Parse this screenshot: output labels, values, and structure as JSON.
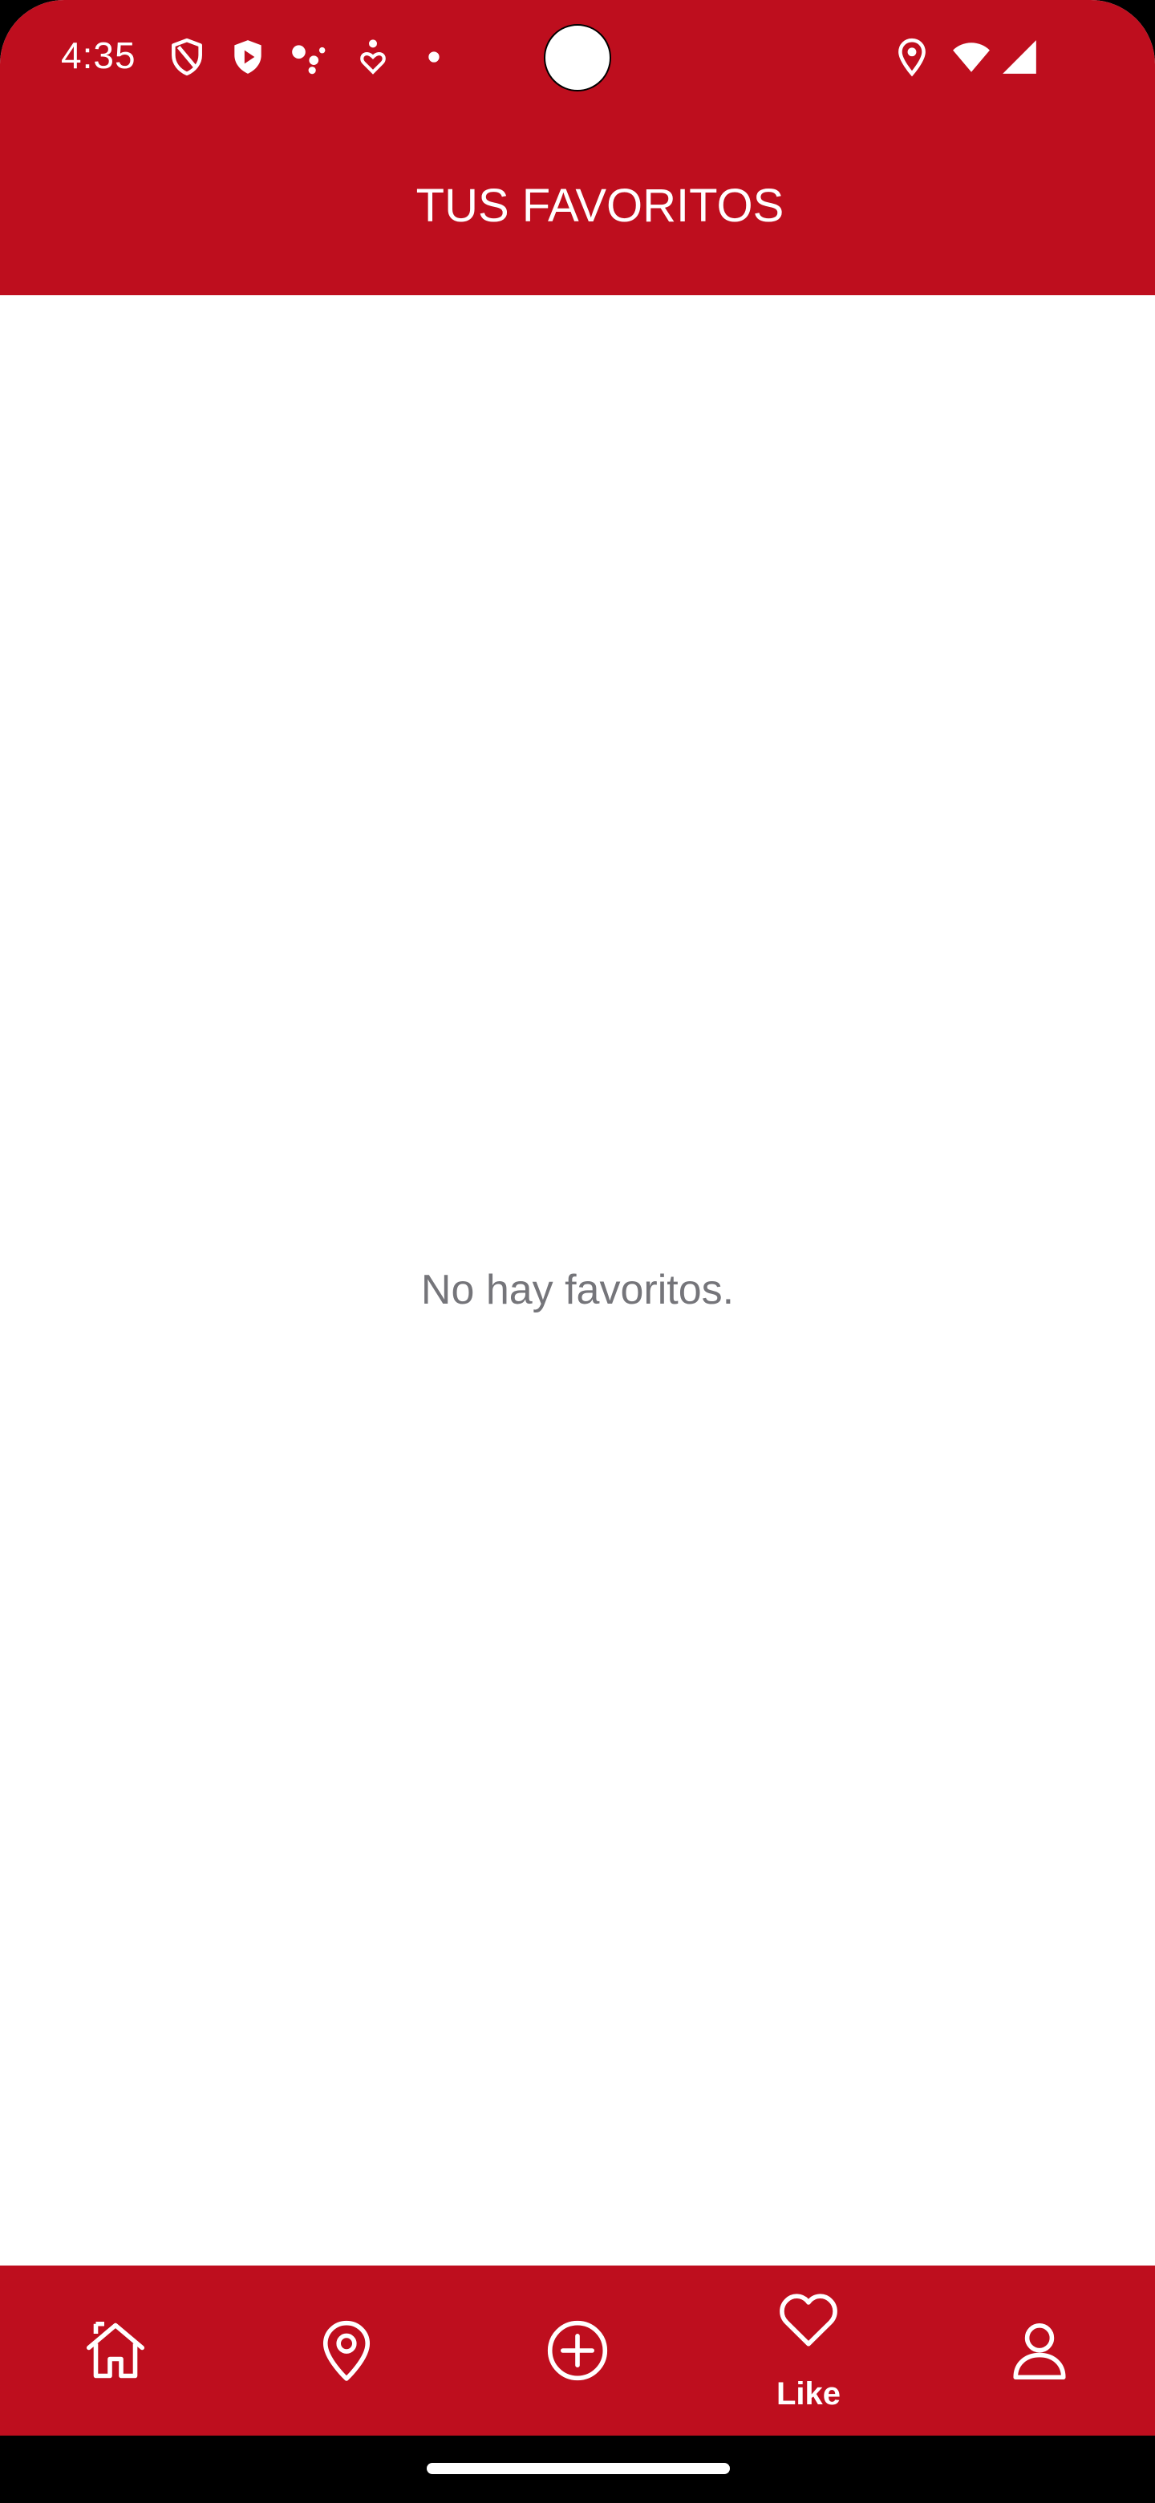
{
  "status_bar": {
    "time": "4:35",
    "left_icons": [
      "shield-outline-icon",
      "shield-play-icon",
      "assistant-dots-icon",
      "accessibility-heart-icon",
      "notification-dot-icon"
    ],
    "right_icons": [
      "location-icon",
      "wifi-icon",
      "cellular-signal-icon"
    ]
  },
  "header": {
    "title": "TUS FAVORITOS"
  },
  "main": {
    "empty_message": "No hay favoritos."
  },
  "bottom_nav": {
    "items": [
      {
        "icon": "home-icon",
        "label": "",
        "active": false
      },
      {
        "icon": "location-pin-icon",
        "label": "",
        "active": false
      },
      {
        "icon": "add-circle-icon",
        "label": "",
        "active": false
      },
      {
        "icon": "heart-icon",
        "label": "Like",
        "active": true
      },
      {
        "icon": "profile-icon",
        "label": "",
        "active": false
      }
    ]
  },
  "colors": {
    "brand_red": "#BE0E1E",
    "text_muted": "#75757A",
    "on_brand": "#FFFFFF"
  }
}
